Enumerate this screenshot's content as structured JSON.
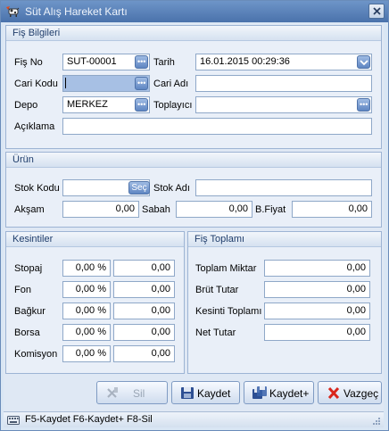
{
  "window": {
    "title": "Süt Alış Hareket Kartı"
  },
  "fis_bilgileri": {
    "header": "Fiş Bilgileri",
    "fis_no": {
      "label": "Fiş No",
      "value": "SUT-00001"
    },
    "tarih": {
      "label": "Tarih",
      "value": "16.01.2015 00:29:36"
    },
    "cari_kodu": {
      "label": "Cari Kodu",
      "value": ""
    },
    "cari_adi": {
      "label": "Cari Adı",
      "value": ""
    },
    "depo": {
      "label": "Depo",
      "value": "MERKEZ"
    },
    "toplayici": {
      "label": "Toplayıcı",
      "value": ""
    },
    "aciklama": {
      "label": "Açıklama",
      "value": ""
    }
  },
  "urun": {
    "header": "Ürün",
    "stok_kodu": {
      "label": "Stok Kodu",
      "value": "",
      "button": "Seç"
    },
    "stok_adi": {
      "label": "Stok Adı",
      "value": ""
    },
    "aksam": {
      "label": "Akşam",
      "value": "0,00"
    },
    "sabah": {
      "label": "Sabah",
      "value": "0,00"
    },
    "b_fiyat": {
      "label": "B.Fiyat",
      "value": "0,00"
    }
  },
  "kesintiler": {
    "header": "Kesintiler",
    "rows": [
      {
        "label": "Stopaj",
        "percent": "0,00 %",
        "amount": "0,00"
      },
      {
        "label": "Fon",
        "percent": "0,00 %",
        "amount": "0,00"
      },
      {
        "label": "Bağkur",
        "percent": "0,00 %",
        "amount": "0,00"
      },
      {
        "label": "Borsa",
        "percent": "0,00 %",
        "amount": "0,00"
      },
      {
        "label": "Komisyon",
        "percent": "0,00 %",
        "amount": "0,00"
      }
    ]
  },
  "fis_toplami": {
    "header": "Fiş Toplamı",
    "rows": [
      {
        "label": "Toplam Miktar",
        "value": "0,00"
      },
      {
        "label": "Brüt Tutar",
        "value": "0,00"
      },
      {
        "label": "Kesinti Toplamı",
        "value": "0,00"
      },
      {
        "label": "Net Tutar",
        "value": "0,00"
      }
    ]
  },
  "buttons": {
    "sil": "Sil",
    "kaydet": "Kaydet",
    "kaydet_plus": "Kaydet+",
    "vazgec": "Vazgeç"
  },
  "status": {
    "text": "F5-Kaydet F6-Kaydet+ F8-Sil"
  },
  "colors": {
    "titlebar": "#4a72ab",
    "panel": "#e9eff8",
    "accent": "#5f86c2",
    "cancel_icon": "#d9261c"
  }
}
